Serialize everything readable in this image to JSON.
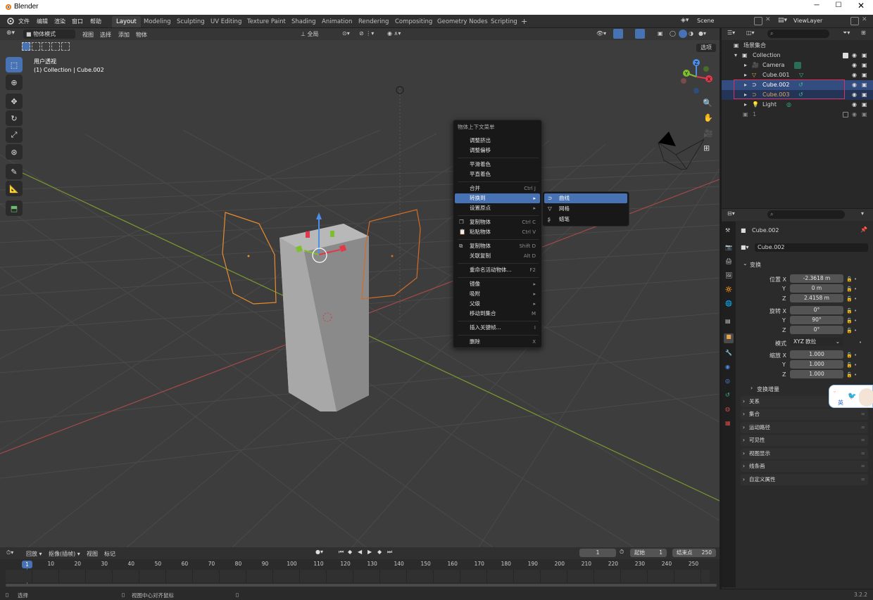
{
  "window": {
    "title": "Blender"
  },
  "menu": [
    "文件",
    "编辑",
    "渲染",
    "窗口",
    "帮助"
  ],
  "workspaces": [
    "Layout",
    "Modeling",
    "Sculpting",
    "UV Editing",
    "Texture Paint",
    "Shading",
    "Animation",
    "Rendering",
    "Compositing",
    "Geometry Nodes",
    "Scripting"
  ],
  "add_tab": "+",
  "scene": "Scene",
  "view_layer": "ViewLayer",
  "viewport": {
    "mode": "物体模式",
    "menus": [
      "视图",
      "选择",
      "添加",
      "物体"
    ],
    "transform_orientation": "全局",
    "options": "选项",
    "info_line1": "用户透视",
    "info_line2": "(1) Collection | Cube.002"
  },
  "gizmo_axes": {
    "x": "X",
    "y": "Y",
    "z": "Z"
  },
  "context_menu": {
    "title": "物体上下文菜单",
    "items": [
      {
        "label": "调整挤出",
        "shortcut": ""
      },
      {
        "label": "调整偏移",
        "shortcut": ""
      },
      {
        "label": "平滑着色",
        "shortcut": ""
      },
      {
        "label": "平直着色",
        "shortcut": ""
      },
      {
        "label": "合并",
        "shortcut": "Ctrl J"
      },
      {
        "label": "转换到",
        "shortcut": "▸"
      },
      {
        "label": "设置原点",
        "shortcut": "▸"
      },
      {
        "label": "复制物体",
        "shortcut": "Ctrl C"
      },
      {
        "label": "粘贴物体",
        "shortcut": "Ctrl V"
      },
      {
        "label": "复制物体",
        "shortcut": "Shift D"
      },
      {
        "label": "关联复制",
        "shortcut": "Alt D"
      },
      {
        "label": "重命名活动物体...",
        "shortcut": "F2"
      },
      {
        "label": "镜像",
        "shortcut": "▸"
      },
      {
        "label": "吸附",
        "shortcut": "▸"
      },
      {
        "label": "父级",
        "shortcut": "▸"
      },
      {
        "label": "移动到集合",
        "shortcut": "M"
      },
      {
        "label": "插入关键帧...",
        "shortcut": "I"
      },
      {
        "label": "删除",
        "shortcut": "X"
      }
    ],
    "submenu": [
      "曲线",
      "网格",
      "蜡笔"
    ]
  },
  "outliner": {
    "root": "场景集合",
    "collection": "Collection",
    "items": [
      "Camera",
      "Cube.001",
      "Cube.002",
      "Cube.003",
      "Light"
    ],
    "extra": "1"
  },
  "properties": {
    "object_name": "Cube.002",
    "data_name": "Cube.002",
    "transform_label": "变换",
    "location_label": "位置 X",
    "rotation_label": "旋转 X",
    "scale_label": "缩放 X",
    "axis_y": "Y",
    "axis_z": "Z",
    "location": [
      "-2.3618 m",
      "0 m",
      "2.4158 m"
    ],
    "rotation": [
      "0°",
      "90°",
      "0°"
    ],
    "mode_label": "模式",
    "rotation_mode": "XYZ 欧拉",
    "scale": [
      "1.000",
      "1.000",
      "1.000"
    ],
    "delta_label": "变换增量",
    "panels": [
      "关系",
      "集合",
      "运动路径",
      "可见性",
      "视图显示",
      "线条画",
      "自定义属性"
    ]
  },
  "ime": {
    "label": "英"
  },
  "timeline": {
    "menus": [
      "回放",
      "抠像(插帧)",
      "视图",
      "标记"
    ],
    "current_frame": "1",
    "start_label": "起始",
    "start": "1",
    "end_label": "结束点",
    "end": "250",
    "ticks": [
      "1",
      "10",
      "20",
      "30",
      "40",
      "50",
      "60",
      "70",
      "80",
      "90",
      "100",
      "110",
      "120",
      "130",
      "140",
      "150",
      "160",
      "170",
      "180",
      "190",
      "200",
      "210",
      "220",
      "230",
      "240",
      "250"
    ]
  },
  "status": {
    "left": "选择",
    "middle": "视图中心对齐鼠标",
    "version": "3.2.2"
  }
}
